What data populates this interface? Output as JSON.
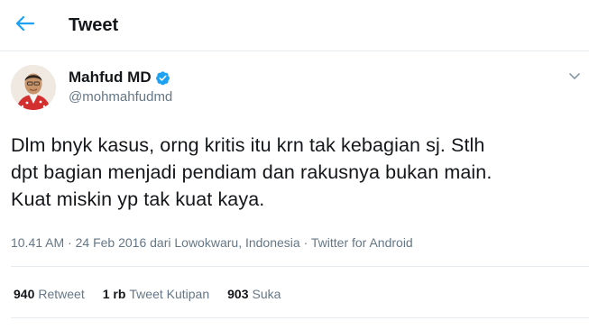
{
  "header": {
    "title": "Tweet",
    "back_icon": "arrow-left-icon",
    "accent_color": "#1da1f2"
  },
  "author": {
    "name": "Mahfud MD",
    "handle": "@mohmahfudmd",
    "verified": true,
    "verified_icon": "verified-badge-icon"
  },
  "tweet": {
    "text": "Dlm bnyk kasus, orng kritis itu krn tak kebagian sj. Stlh\ndpt bagian menjadi pendiam dan rakusnya bukan main.\nKuat miskin yp tak kuat kaya.",
    "time": "10.41 AM",
    "date": "24 Feb 2016",
    "location_prefix": "dari",
    "location": "Lowokwaru, Indonesia",
    "source": "Twitter for Android",
    "separator": "·"
  },
  "stats": {
    "retweets": {
      "count": "940",
      "label": "Retweet"
    },
    "quotes": {
      "count": "1 rb",
      "label": "Tweet Kutipan"
    },
    "likes": {
      "count": "903",
      "label": "Suka"
    }
  },
  "menu_icon": "chevron-down-icon"
}
